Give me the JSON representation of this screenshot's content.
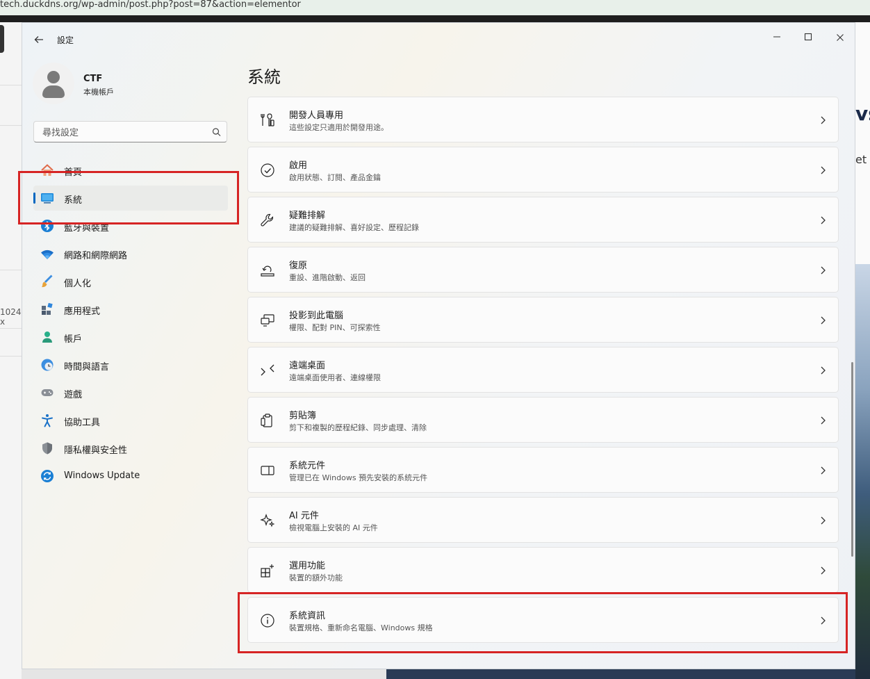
{
  "browser": {
    "url": "tech.duckdns.org/wp-admin/post.php?post=87&action=elementor",
    "left_fragment": "1024 x",
    "right_heading_fragment": "vs",
    "right_text_fragment": "et"
  },
  "window": {
    "title": "設定",
    "controls": {
      "minimize": "—",
      "maximize": "☐",
      "close": "✕"
    }
  },
  "user": {
    "name": "CTF",
    "account_type": "本機帳戶"
  },
  "search": {
    "placeholder": "尋找設定"
  },
  "sidebar": {
    "items": [
      {
        "label": "首頁",
        "icon": "home-icon",
        "selected": false
      },
      {
        "label": "系統",
        "icon": "monitor-icon",
        "selected": true
      },
      {
        "label": "藍牙與裝置",
        "icon": "bluetooth-icon",
        "selected": false
      },
      {
        "label": "網路和網際網路",
        "icon": "wifi-icon",
        "selected": false
      },
      {
        "label": "個人化",
        "icon": "brush-icon",
        "selected": false
      },
      {
        "label": "應用程式",
        "icon": "apps-icon",
        "selected": false
      },
      {
        "label": "帳戶",
        "icon": "person-icon",
        "selected": false
      },
      {
        "label": "時間與語言",
        "icon": "clock-globe-icon",
        "selected": false
      },
      {
        "label": "遊戲",
        "icon": "gamepad-icon",
        "selected": false
      },
      {
        "label": "協助工具",
        "icon": "accessibility-icon",
        "selected": false
      },
      {
        "label": "隱私權與安全性",
        "icon": "shield-icon",
        "selected": false
      },
      {
        "label": "Windows Update",
        "icon": "update-icon",
        "selected": false
      }
    ]
  },
  "main": {
    "title": "系統",
    "cards": [
      {
        "title": "開發人員專用",
        "subtitle": "這些設定只適用於開發用途。",
        "icon": "developer-tools-icon"
      },
      {
        "title": "啟用",
        "subtitle": "啟用狀態、訂閱、產品金鑰",
        "icon": "check-circle-icon"
      },
      {
        "title": "疑難排解",
        "subtitle": "建議的疑難排解、喜好設定、歷程記錄",
        "icon": "wrench-icon"
      },
      {
        "title": "復原",
        "subtitle": "重設、進階啟動、返回",
        "icon": "recovery-icon"
      },
      {
        "title": "投影到此電腦",
        "subtitle": "權限、配對 PIN、可探索性",
        "icon": "projection-icon"
      },
      {
        "title": "遠端桌面",
        "subtitle": "遠端桌面使用者、連線權限",
        "icon": "remote-desktop-icon"
      },
      {
        "title": "剪貼簿",
        "subtitle": "剪下和複製的歷程紀錄、同步處理、清除",
        "icon": "clipboard-icon"
      },
      {
        "title": "系統元件",
        "subtitle": "管理已在 Windows 預先安裝的系統元件",
        "icon": "system-components-icon"
      },
      {
        "title": "AI 元件",
        "subtitle": "檢視電腦上安裝的 AI 元件",
        "icon": "sparkle-icon"
      },
      {
        "title": "選用功能",
        "subtitle": "裝置的額外功能",
        "icon": "optional-features-icon"
      },
      {
        "title": "系統資訊",
        "subtitle": "裝置規格、重新命名電腦、Windows 規格",
        "icon": "info-icon"
      }
    ]
  },
  "colors": {
    "accent": "#0067c0",
    "highlight": "#d62424"
  }
}
